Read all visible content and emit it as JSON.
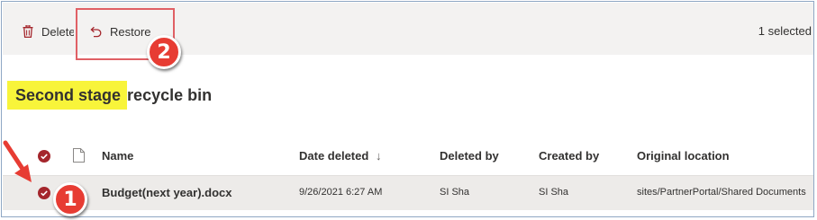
{
  "toolbar": {
    "delete_label": "Delete",
    "restore_label": "Restore",
    "selected_count": "1 selected"
  },
  "page": {
    "title_highlighted": "Second stage ",
    "title_rest": "recycle bin"
  },
  "table": {
    "columns": [
      "Name",
      "Date deleted",
      "Deleted by",
      "Created by",
      "Original location"
    ],
    "sort_indicator": "↓",
    "rows": [
      {
        "name": "Budget(next year).docx",
        "date_deleted": "9/26/2021 6:27 AM",
        "deleted_by": "SI Sha",
        "created_by": "SI Sha",
        "original_location": "sites/PartnerPortal/Shared Documents",
        "selected": true
      }
    ]
  },
  "annotations": {
    "step_1": "1",
    "step_2": "2"
  },
  "colors": {
    "accent": "#a4262c",
    "toolbar_bg": "#f3f2f1",
    "selected_row_bg": "#edebe9",
    "highlight": "#f8f43a",
    "annotation_red": "#e73c33"
  }
}
